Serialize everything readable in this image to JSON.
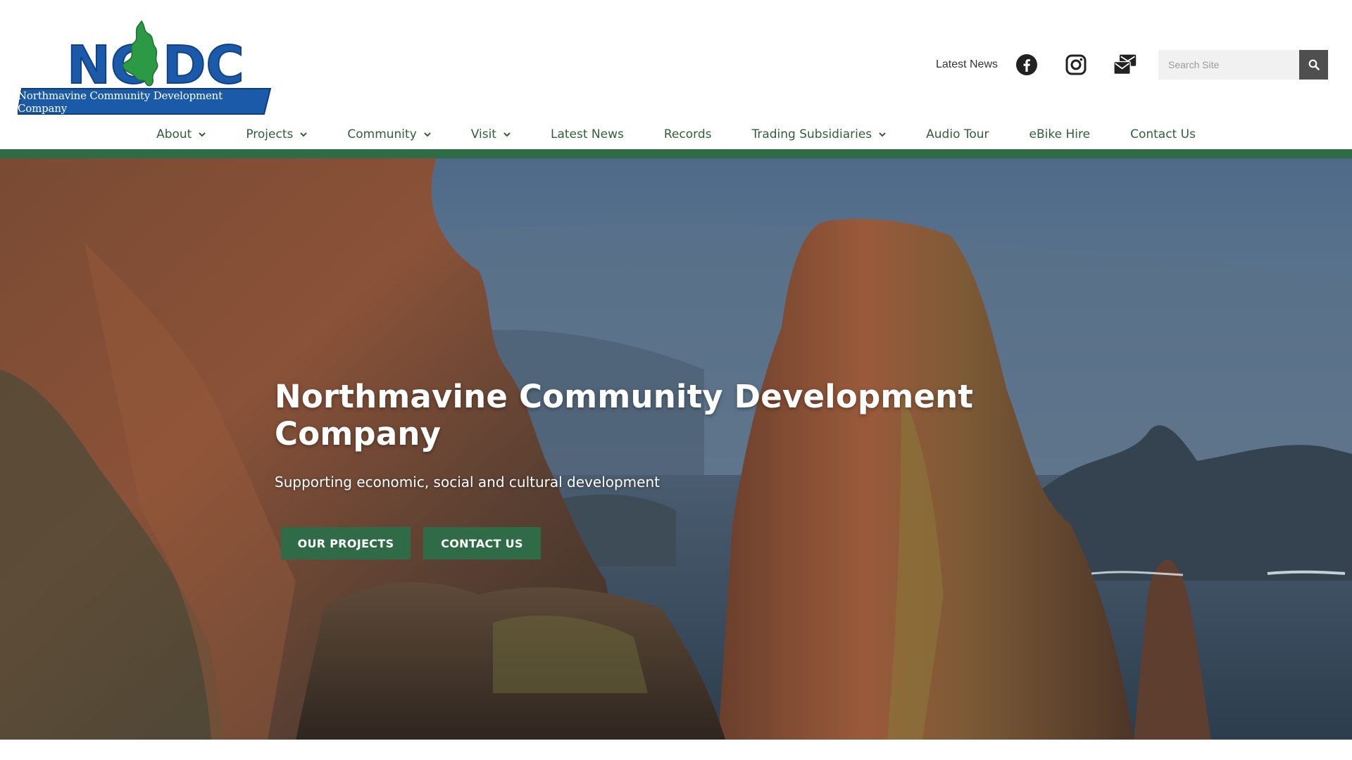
{
  "logo": {
    "text": "NCDC",
    "tagline": "Northmavine Community Development Company",
    "color_blue": "#1b5aa8",
    "color_green": "#2c9a45"
  },
  "utility": {
    "latest_news": "Latest News",
    "social": [
      "facebook-icon",
      "instagram-icon",
      "mail-icon"
    ],
    "search_placeholder": "Search Site",
    "search_icon": "search-icon"
  },
  "nav": {
    "items": [
      {
        "label": "About",
        "dropdown": true
      },
      {
        "label": "Projects",
        "dropdown": true
      },
      {
        "label": "Community",
        "dropdown": true
      },
      {
        "label": "Visit",
        "dropdown": true
      },
      {
        "label": "Latest News",
        "dropdown": false
      },
      {
        "label": "Records",
        "dropdown": false
      },
      {
        "label": "Trading Subsidiaries",
        "dropdown": true
      },
      {
        "label": "Audio Tour",
        "dropdown": false
      },
      {
        "label": "eBike Hire",
        "dropdown": false
      },
      {
        "label": "Contact Us",
        "dropdown": false
      }
    ]
  },
  "colors": {
    "brand_green": "#2e6b46",
    "nav_text": "#2f5f3a"
  },
  "hero": {
    "title": "Northmavine Community Development Company",
    "subtitle": "Supporting economic, social and cultural development",
    "buttons": {
      "projects": "OUR PROJECTS",
      "contact": "CONTACT US"
    }
  }
}
